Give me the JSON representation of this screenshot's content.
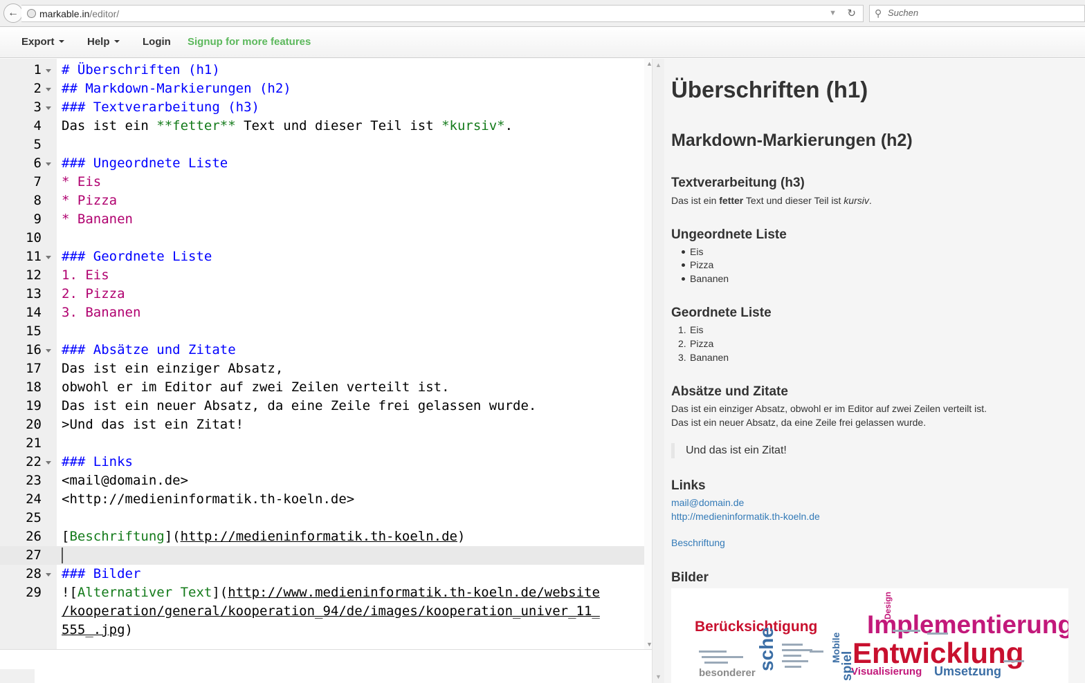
{
  "browser": {
    "url_host": "markable.in",
    "url_path": "/editor/",
    "search_placeholder": "Suchen"
  },
  "nav": {
    "export": "Export",
    "help": "Help",
    "login": "Login",
    "signup": "Signup for more features"
  },
  "editor": {
    "lines": [
      {
        "n": "1",
        "fold": true,
        "parts": [
          {
            "t": "# Überschriften (h1)",
            "c": "head"
          }
        ]
      },
      {
        "n": "2",
        "fold": true,
        "parts": [
          {
            "t": "## Markdown-Markierungen (h2)",
            "c": "head"
          }
        ]
      },
      {
        "n": "3",
        "fold": true,
        "parts": [
          {
            "t": "### Textverarbeitung (h3)",
            "c": "head"
          }
        ]
      },
      {
        "n": "4",
        "parts": [
          {
            "t": "Das ist ein ",
            "c": "plain"
          },
          {
            "t": "**fetter**",
            "c": "green"
          },
          {
            "t": " Text und dieser Teil ist ",
            "c": "plain"
          },
          {
            "t": "*kursiv*",
            "c": "green"
          },
          {
            "t": ".",
            "c": "plain"
          }
        ]
      },
      {
        "n": "5",
        "parts": []
      },
      {
        "n": "6",
        "fold": true,
        "parts": [
          {
            "t": "### Ungeordnete Liste",
            "c": "head"
          }
        ]
      },
      {
        "n": "7",
        "parts": [
          {
            "t": "* Eis",
            "c": "list"
          }
        ]
      },
      {
        "n": "8",
        "parts": [
          {
            "t": "* Pizza",
            "c": "list"
          }
        ]
      },
      {
        "n": "9",
        "parts": [
          {
            "t": "* Bananen",
            "c": "list"
          }
        ]
      },
      {
        "n": "10",
        "parts": []
      },
      {
        "n": "11",
        "fold": true,
        "parts": [
          {
            "t": "### Geordnete Liste",
            "c": "head"
          }
        ]
      },
      {
        "n": "12",
        "parts": [
          {
            "t": "1. Eis",
            "c": "list"
          }
        ]
      },
      {
        "n": "13",
        "parts": [
          {
            "t": "2. Pizza",
            "c": "list"
          }
        ]
      },
      {
        "n": "14",
        "parts": [
          {
            "t": "3. Bananen",
            "c": "list"
          }
        ]
      },
      {
        "n": "15",
        "parts": []
      },
      {
        "n": "16",
        "fold": true,
        "parts": [
          {
            "t": "### Absätze und Zitate",
            "c": "head"
          }
        ]
      },
      {
        "n": "17",
        "parts": [
          {
            "t": "Das ist ein einziger Absatz,",
            "c": "plain"
          }
        ]
      },
      {
        "n": "18",
        "parts": [
          {
            "t": "obwohl er im Editor auf zwei Zeilen verteilt ist.",
            "c": "plain"
          }
        ]
      },
      {
        "n": "19",
        "parts": [
          {
            "t": "Das ist ein neuer Absatz, da eine Zeile frei gelassen wurde.",
            "c": "plain"
          }
        ]
      },
      {
        "n": "20",
        "parts": [
          {
            "t": ">Und das ist ein Zitat!",
            "c": "plain"
          }
        ]
      },
      {
        "n": "21",
        "parts": []
      },
      {
        "n": "22",
        "fold": true,
        "parts": [
          {
            "t": "### Links",
            "c": "head"
          }
        ]
      },
      {
        "n": "23",
        "parts": [
          {
            "t": "<mail@domain.de>",
            "c": "plain"
          }
        ]
      },
      {
        "n": "24",
        "parts": [
          {
            "t": "<http://medieninformatik.th-koeln.de>",
            "c": "plain"
          }
        ]
      },
      {
        "n": "25",
        "parts": []
      },
      {
        "n": "26",
        "parts": [
          {
            "t": "[",
            "c": "plain"
          },
          {
            "t": "Beschriftung",
            "c": "green"
          },
          {
            "t": "](",
            "c": "plain"
          },
          {
            "t": "http://medieninformatik.th-koeln.de",
            "c": "link"
          },
          {
            "t": ")",
            "c": "plain"
          }
        ]
      },
      {
        "n": "27",
        "active": true,
        "parts": []
      },
      {
        "n": "28",
        "fold": true,
        "parts": [
          {
            "t": "### Bilder",
            "c": "head"
          }
        ]
      },
      {
        "n": "29",
        "parts": [
          {
            "t": "![",
            "c": "plain"
          },
          {
            "t": "Alternativer Text",
            "c": "green"
          },
          {
            "t": "](",
            "c": "plain"
          },
          {
            "t": "http://www.medieninformatik.th-koeln.de/website",
            "c": "link"
          }
        ]
      },
      {
        "n": "",
        "parts": [
          {
            "t": "/kooperation/general/kooperation_94/de/images/kooperation_univer_11_",
            "c": "link"
          }
        ]
      },
      {
        "n": "",
        "parts": [
          {
            "t": "555_.jpg",
            "c": "link"
          },
          {
            "t": ")",
            "c": "plain"
          }
        ]
      }
    ]
  },
  "preview": {
    "h1": "Überschriften (h1)",
    "h2": "Markdown-Markierungen (h2)",
    "h3_text": "Textverarbeitung (h3)",
    "p_text_a": "Das ist ein ",
    "p_text_bold": "fetter",
    "p_text_b": " Text und dieser Teil ist ",
    "p_text_italic": "kursiv",
    "p_text_c": ".",
    "h3_ul": "Ungeordnete Liste",
    "ul": [
      "Eis",
      "Pizza",
      "Bananen"
    ],
    "h3_ol": "Geordnete Liste",
    "ol": [
      "Eis",
      "Pizza",
      "Bananen"
    ],
    "ol_nums": [
      "1.",
      "2.",
      "3."
    ],
    "h3_abs": "Absätze und Zitate",
    "abs_p1": "Das ist ein einziger Absatz, obwohl er im Editor auf zwei Zeilen verteilt ist.",
    "abs_p2": "Das ist ein neuer Absatz, da eine Zeile frei gelassen wurde.",
    "quote": "Und das ist ein Zitat!",
    "h3_links": "Links",
    "link_mail": "mail@domain.de",
    "link_url": "http://medieninformatik.th-koeln.de",
    "link_label": "Beschriftung",
    "h3_bilder": "Bilder",
    "cloud_words": [
      "Berücksichtigung",
      "Implementierung",
      "Entwicklung",
      "Visualisierung",
      "Umsetzung",
      "Design",
      "besonderer",
      "Mobile",
      "spiel",
      "sche"
    ]
  },
  "colors": {
    "md_heading": "#0000ff",
    "md_list": "#b0006f",
    "md_emphasis": "#137a1a",
    "signup": "#5cb85c",
    "preview_link": "#337ab7",
    "cloud_red": "#c8102e",
    "cloud_magenta": "#c2187a"
  }
}
